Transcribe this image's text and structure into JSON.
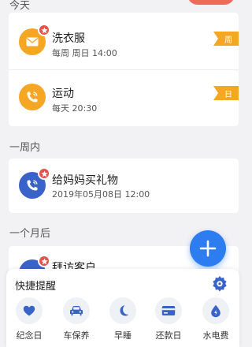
{
  "sections": {
    "today": "今天",
    "this_week": "一周内",
    "this_month": "一个月后"
  },
  "reminders": {
    "laundry": {
      "title": "洗衣服",
      "schedule": "每周 周日 14:00",
      "tag": "周",
      "icon": "mail-icon",
      "color": "#f5a623"
    },
    "exercise": {
      "title": "运动",
      "schedule": "每天 20:30",
      "tag": "日",
      "icon": "phone-icon",
      "color": "#f5a623"
    },
    "gift": {
      "title": "给妈妈买礼物",
      "schedule": "2019年05月08日 12:00",
      "icon": "phone-icon",
      "color": "#3a63c9"
    },
    "visit": {
      "title": "拜访客户",
      "icon": "phone-icon",
      "color": "#3a63c9"
    }
  },
  "add_button": {
    "icon": "plus-icon",
    "color": "#2d7df0"
  },
  "quick_panel": {
    "title": "快捷提醒",
    "settings_icon": "settings-icon",
    "shortcuts": [
      {
        "label": "纪念日",
        "icon": "heart-icon"
      },
      {
        "label": "车保养",
        "icon": "car-icon"
      },
      {
        "label": "早睡",
        "icon": "moon-icon"
      },
      {
        "label": "还款日",
        "icon": "card-icon"
      },
      {
        "label": "水电费",
        "icon": "water-drop-icon"
      }
    ]
  },
  "colors": {
    "accent": "#2d7df0",
    "orange": "#f5a623",
    "badge_red": "#e6504a",
    "dark_blue": "#3a63c9"
  }
}
